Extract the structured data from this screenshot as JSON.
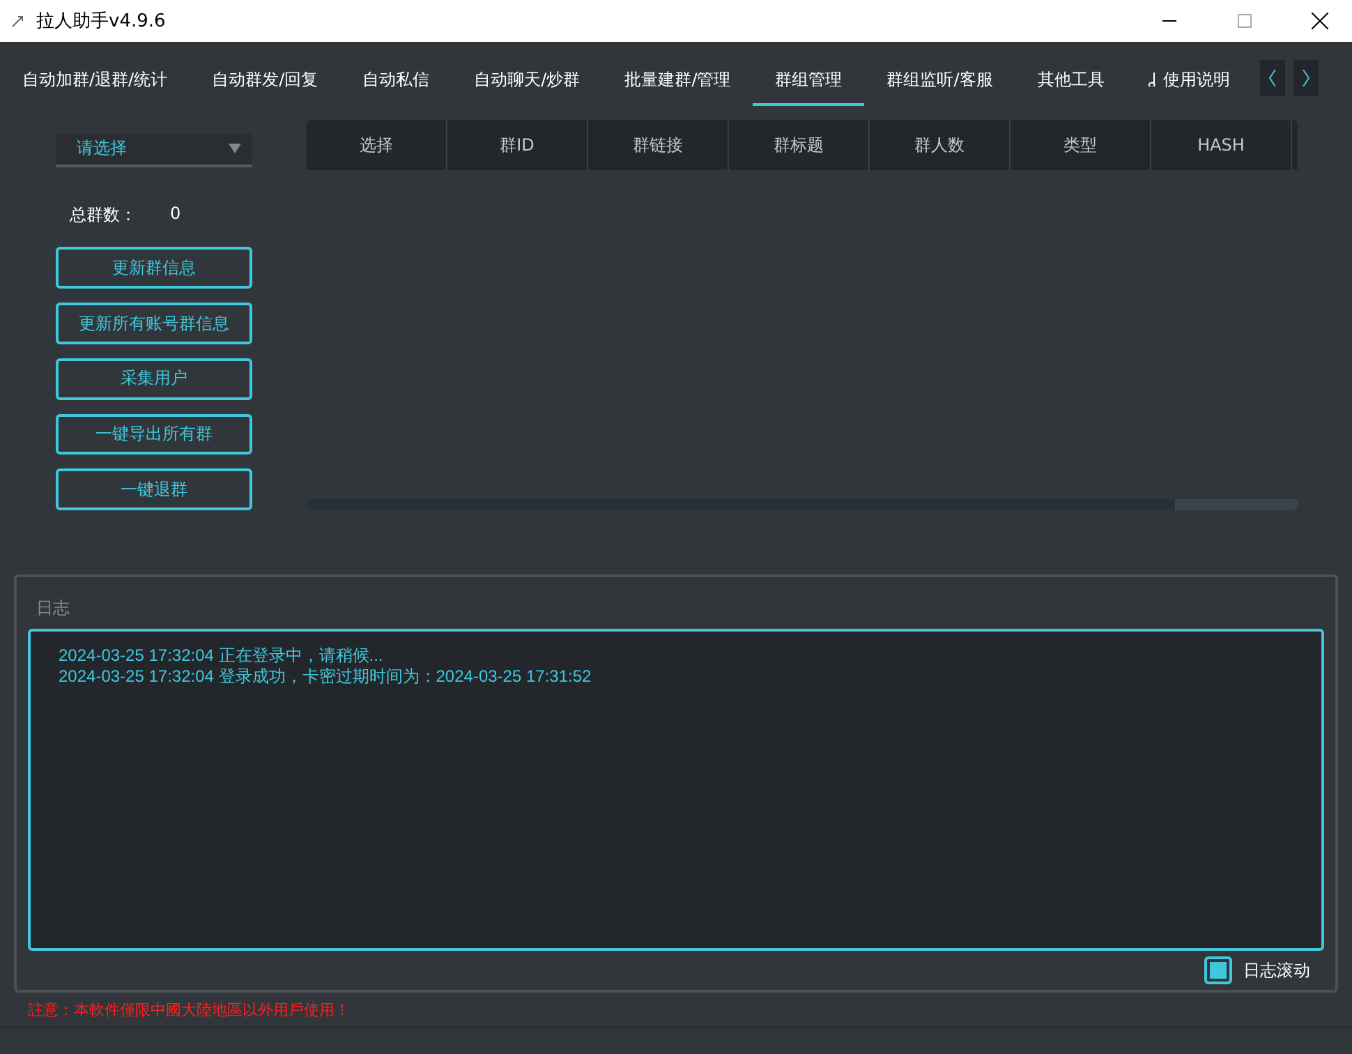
{
  "window": {
    "title": "拉人助手v4.9.6"
  },
  "tabs": [
    {
      "label": "自动加群/退群/统计",
      "selected": false
    },
    {
      "label": "自动群发/回复",
      "selected": false
    },
    {
      "label": "自动私信",
      "selected": false
    },
    {
      "label": "自动聊天/炒群",
      "selected": false
    },
    {
      "label": "批量建群/管理",
      "selected": false
    },
    {
      "label": "群组管理",
      "selected": true
    },
    {
      "label": "群组监听/客服",
      "selected": false
    },
    {
      "label": "其他工具",
      "selected": false
    },
    {
      "label": "使用说明",
      "selected": false
    }
  ],
  "group_select": {
    "value": "请选择"
  },
  "total_groups": {
    "label": "总群数：",
    "value": "0"
  },
  "actions": [
    "更新群信息",
    "更新所有账号群信息",
    "采集用户",
    "一键导出所有群",
    "一键退群"
  ],
  "table": {
    "columns": [
      "选择",
      "群ID",
      "群链接",
      "群标题",
      "群人数",
      "类型",
      "HASH"
    ]
  },
  "log": {
    "title": "日志",
    "lines": [
      "2024-03-25 17:32:04 正在登录中，请稍候...",
      "2024-03-25 17:32:04 登录成功，卡密过期时间为：2024-03-25 17:31:52"
    ],
    "autoscroll": {
      "label": "日志滚动",
      "checked": true
    }
  },
  "status_bar": {
    "notice": "註意：本軟件僅限中國大陸地區以外用戶使用！"
  }
}
